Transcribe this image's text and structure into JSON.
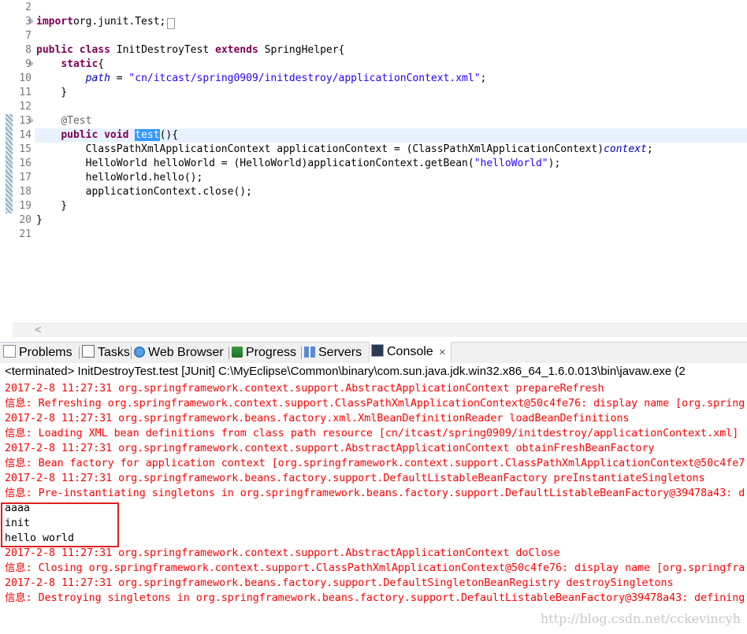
{
  "editor": {
    "lines": [
      {
        "num": "2",
        "tokens": []
      },
      {
        "num": "3",
        "fold": "⊕",
        "tokens": [
          [
            "kw",
            "import"
          ],
          [
            "",
            "org.junit.Test;"
          ],
          [
            "box",
            "…"
          ]
        ]
      },
      {
        "num": "7",
        "tokens": []
      },
      {
        "num": "8",
        "tokens": [
          [
            "kw",
            "public"
          ],
          [
            "",
            " "
          ],
          [
            "kw",
            "class"
          ],
          [
            "",
            " InitDestroyTest "
          ],
          [
            "kw",
            "extends"
          ],
          [
            "",
            " SpringHelper{"
          ]
        ]
      },
      {
        "num": "9",
        "fold": "⊖",
        "tokens": [
          [
            "",
            "    "
          ],
          [
            "kw",
            "static"
          ],
          [
            "",
            "{"
          ]
        ]
      },
      {
        "num": "10",
        "tokens": [
          [
            "",
            "        "
          ],
          [
            "fld",
            "path"
          ],
          [
            "",
            " = "
          ],
          [
            "str",
            "\"cn/itcast/spring0909/initdestroy/applicationContext.xml\""
          ],
          [
            "",
            ";"
          ]
        ]
      },
      {
        "num": "11",
        "tokens": [
          [
            "",
            "    }"
          ]
        ]
      },
      {
        "num": "12",
        "tokens": []
      },
      {
        "num": "13",
        "fold": "⊖",
        "tokens": [
          [
            "",
            "    "
          ],
          [
            "ann",
            "@Test"
          ]
        ]
      },
      {
        "num": "14",
        "highlight": true,
        "tokens": [
          [
            "",
            "    "
          ],
          [
            "kw",
            "public"
          ],
          [
            "",
            " "
          ],
          [
            "kw",
            "void"
          ],
          [
            "",
            " "
          ],
          [
            "sel",
            "test"
          ],
          [
            "",
            "(){"
          ]
        ]
      },
      {
        "num": "15",
        "tokens": [
          [
            "",
            "        ClassPathXmlApplicationContext applicationContext = (ClassPathXmlApplicationContext)"
          ],
          [
            "fld",
            "context"
          ],
          [
            "",
            ";"
          ]
        ]
      },
      {
        "num": "16",
        "tokens": [
          [
            "",
            "        HelloWorld helloWorld = (HelloWorld)applicationContext.getBean("
          ],
          [
            "str",
            "\"helloWorld\""
          ],
          [
            "",
            ");"
          ]
        ]
      },
      {
        "num": "17",
        "tokens": [
          [
            "",
            "        helloWorld.hello();"
          ]
        ]
      },
      {
        "num": "18",
        "tokens": [
          [
            "",
            "        applicationContext.close();"
          ]
        ]
      },
      {
        "num": "19",
        "tokens": [
          [
            "",
            "    }"
          ]
        ]
      },
      {
        "num": "20",
        "tokens": [
          [
            "",
            "}"
          ]
        ]
      },
      {
        "num": "21",
        "tokens": []
      }
    ],
    "scroll_left_glyph": "<"
  },
  "tabs": [
    {
      "label": "Problems",
      "icon": "problems-icon"
    },
    {
      "label": "Tasks",
      "icon": "tasks-icon"
    },
    {
      "label": "Web Browser",
      "icon": "web-browser-icon"
    },
    {
      "label": "Progress",
      "icon": "progress-icon"
    },
    {
      "label": "Servers",
      "icon": "servers-icon"
    },
    {
      "label": "Console",
      "icon": "console-icon",
      "close": "✕",
      "active": true
    }
  ],
  "console": {
    "description": "<terminated> InitDestroyTest.test [JUnit] C:\\MyEclipse\\Common\\binary\\com.sun.java.jdk.win32.x86_64_1.6.0.013\\bin\\javaw.exe (2",
    "lines": [
      {
        "type": "err",
        "text": "2017-2-8 11:27:31 org.springframework.context.support.AbstractApplicationContext prepareRefresh"
      },
      {
        "type": "err",
        "text": "信息: Refreshing org.springframework.context.support.ClassPathXmlApplicationContext@50c4fe76: display name [org.spring"
      },
      {
        "type": "err",
        "text": "2017-2-8 11:27:31 org.springframework.beans.factory.xml.XmlBeanDefinitionReader loadBeanDefinitions"
      },
      {
        "type": "err",
        "text": "信息: Loading XML bean definitions from class path resource [cn/itcast/spring0909/initdestroy/applicationContext.xml]"
      },
      {
        "type": "err",
        "text": "2017-2-8 11:27:31 org.springframework.context.support.AbstractApplicationContext obtainFreshBeanFactory"
      },
      {
        "type": "err",
        "text": "信息: Bean factory for application context [org.springframework.context.support.ClassPathXmlApplicationContext@50c4fe7"
      },
      {
        "type": "err",
        "text": "2017-2-8 11:27:31 org.springframework.beans.factory.support.DefaultListableBeanFactory preInstantiateSingletons"
      },
      {
        "type": "err",
        "text": "信息: Pre-instantiating singletons in org.springframework.beans.factory.support.DefaultListableBeanFactory@39478a43: d"
      },
      {
        "type": "std",
        "text": "aaaa"
      },
      {
        "type": "std",
        "text": "init"
      },
      {
        "type": "std",
        "text": "hello world"
      },
      {
        "type": "err",
        "text": "2017-2-8 11:27:31 org.springframework.context.support.AbstractApplicationContext doClose"
      },
      {
        "type": "err",
        "text": "信息: Closing org.springframework.context.support.ClassPathXmlApplicationContext@50c4fe76: display name [org.springfra"
      },
      {
        "type": "err",
        "text": "2017-2-8 11:27:31 org.springframework.beans.factory.support.DefaultSingletonBeanRegistry destroySingletons"
      },
      {
        "type": "err",
        "text": "信息: Destroying singletons in org.springframework.beans.factory.support.DefaultListableBeanFactory@39478a43: defining"
      }
    ],
    "watermark": "http://blog.csdn.net/cckevincyh"
  },
  "colors": {
    "keyword": "#7f0055",
    "string": "#2a00ff",
    "field": "#0000c0",
    "stderr": "#ff0000",
    "highlight_box": "#e02020"
  }
}
